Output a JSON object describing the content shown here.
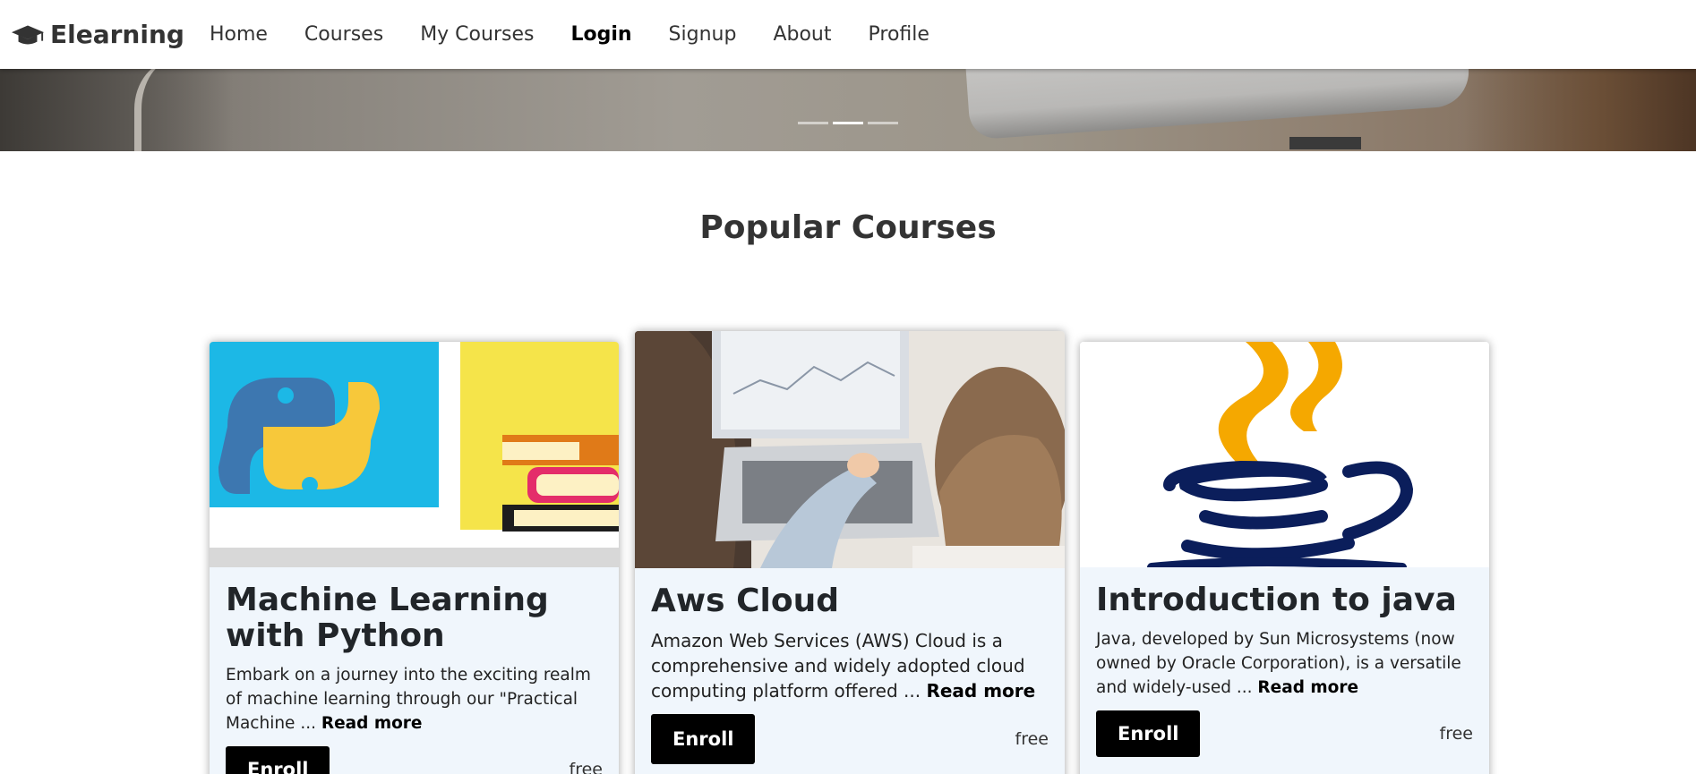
{
  "navbar": {
    "brand": "Elearning",
    "links": [
      {
        "label": "Home"
      },
      {
        "label": "Courses"
      },
      {
        "label": "My Courses"
      },
      {
        "label": "Login"
      },
      {
        "label": "Signup"
      },
      {
        "label": "About"
      },
      {
        "label": "Profile"
      }
    ],
    "active": "Login"
  },
  "hero": {
    "indicators": 3,
    "active_indicator": 2
  },
  "popular": {
    "title": "Popular Courses",
    "courses": [
      {
        "image": "python-logo-icon",
        "title": "Machine Learning with Python",
        "description": "Embark on a journey into the exciting realm of machine learning through our \"Practical Machine ...",
        "read_more": "Read more",
        "button": "Enroll",
        "price": "free"
      },
      {
        "image": "laptop-people-photo",
        "title": "Aws Cloud",
        "description": "Amazon Web Services (AWS) Cloud is a comprehensive and widely adopted cloud computing platform offered ...",
        "read_more": "Read more",
        "button": "Enroll",
        "price": "free"
      },
      {
        "image": "java-logo-icon",
        "title": "Introduction to java",
        "description": "Java, developed by Sun Microsystems (now owned by Oracle Corporation), is a versatile and widely-used ...",
        "read_more": "Read more",
        "button": "Enroll",
        "price": "free"
      }
    ]
  },
  "colors": {
    "button_bg": "#000000",
    "card_bg": "#f0f6fc",
    "text": "#212529"
  }
}
